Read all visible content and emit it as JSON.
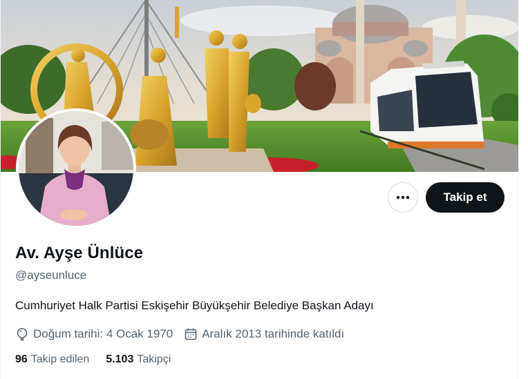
{
  "profile": {
    "display_name": "Av. Ayşe Ünlüce",
    "handle": "@ayseunluce",
    "bio": "Cumhuriyet Halk Partisi Eskişehir Büyükşehir Belediye Başkan Adayı",
    "birthday": "Doğum tarihi: 4 Ocak 1970",
    "joined": "Aralık 2013 tarihinde katıldı"
  },
  "actions": {
    "more_icon": "more-horizontal-icon",
    "follow_label": "Takip et"
  },
  "stats": {
    "following_count": "96",
    "following_label": "Takip edilen",
    "followers_count": "5.103",
    "followers_label": "Takipçi"
  },
  "icons": {
    "birthday": "balloon-icon",
    "joined": "calendar-icon"
  },
  "colors": {
    "primary_text": "#0f1419",
    "secondary_text": "#536471",
    "follow_button_bg": "#0f1419",
    "border": "#cfd9de"
  }
}
